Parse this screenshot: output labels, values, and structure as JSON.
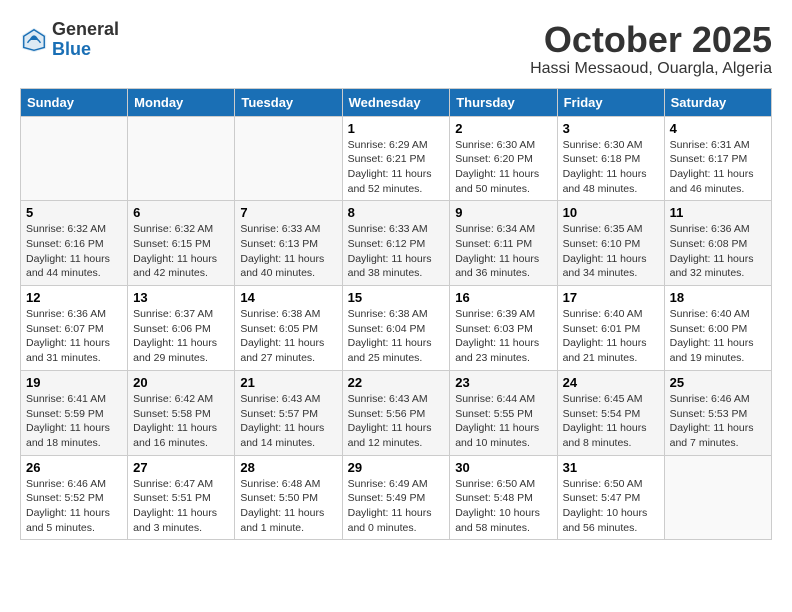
{
  "header": {
    "logo_general": "General",
    "logo_blue": "Blue",
    "month": "October 2025",
    "location": "Hassi Messaoud, Ouargla, Algeria"
  },
  "weekdays": [
    "Sunday",
    "Monday",
    "Tuesday",
    "Wednesday",
    "Thursday",
    "Friday",
    "Saturday"
  ],
  "weeks": [
    [
      {
        "day": "",
        "sunrise": "",
        "sunset": "",
        "daylight": ""
      },
      {
        "day": "",
        "sunrise": "",
        "sunset": "",
        "daylight": ""
      },
      {
        "day": "",
        "sunrise": "",
        "sunset": "",
        "daylight": ""
      },
      {
        "day": "1",
        "sunrise": "Sunrise: 6:29 AM",
        "sunset": "Sunset: 6:21 PM",
        "daylight": "Daylight: 11 hours and 52 minutes."
      },
      {
        "day": "2",
        "sunrise": "Sunrise: 6:30 AM",
        "sunset": "Sunset: 6:20 PM",
        "daylight": "Daylight: 11 hours and 50 minutes."
      },
      {
        "day": "3",
        "sunrise": "Sunrise: 6:30 AM",
        "sunset": "Sunset: 6:18 PM",
        "daylight": "Daylight: 11 hours and 48 minutes."
      },
      {
        "day": "4",
        "sunrise": "Sunrise: 6:31 AM",
        "sunset": "Sunset: 6:17 PM",
        "daylight": "Daylight: 11 hours and 46 minutes."
      }
    ],
    [
      {
        "day": "5",
        "sunrise": "Sunrise: 6:32 AM",
        "sunset": "Sunset: 6:16 PM",
        "daylight": "Daylight: 11 hours and 44 minutes."
      },
      {
        "day": "6",
        "sunrise": "Sunrise: 6:32 AM",
        "sunset": "Sunset: 6:15 PM",
        "daylight": "Daylight: 11 hours and 42 minutes."
      },
      {
        "day": "7",
        "sunrise": "Sunrise: 6:33 AM",
        "sunset": "Sunset: 6:13 PM",
        "daylight": "Daylight: 11 hours and 40 minutes."
      },
      {
        "day": "8",
        "sunrise": "Sunrise: 6:33 AM",
        "sunset": "Sunset: 6:12 PM",
        "daylight": "Daylight: 11 hours and 38 minutes."
      },
      {
        "day": "9",
        "sunrise": "Sunrise: 6:34 AM",
        "sunset": "Sunset: 6:11 PM",
        "daylight": "Daylight: 11 hours and 36 minutes."
      },
      {
        "day": "10",
        "sunrise": "Sunrise: 6:35 AM",
        "sunset": "Sunset: 6:10 PM",
        "daylight": "Daylight: 11 hours and 34 minutes."
      },
      {
        "day": "11",
        "sunrise": "Sunrise: 6:36 AM",
        "sunset": "Sunset: 6:08 PM",
        "daylight": "Daylight: 11 hours and 32 minutes."
      }
    ],
    [
      {
        "day": "12",
        "sunrise": "Sunrise: 6:36 AM",
        "sunset": "Sunset: 6:07 PM",
        "daylight": "Daylight: 11 hours and 31 minutes."
      },
      {
        "day": "13",
        "sunrise": "Sunrise: 6:37 AM",
        "sunset": "Sunset: 6:06 PM",
        "daylight": "Daylight: 11 hours and 29 minutes."
      },
      {
        "day": "14",
        "sunrise": "Sunrise: 6:38 AM",
        "sunset": "Sunset: 6:05 PM",
        "daylight": "Daylight: 11 hours and 27 minutes."
      },
      {
        "day": "15",
        "sunrise": "Sunrise: 6:38 AM",
        "sunset": "Sunset: 6:04 PM",
        "daylight": "Daylight: 11 hours and 25 minutes."
      },
      {
        "day": "16",
        "sunrise": "Sunrise: 6:39 AM",
        "sunset": "Sunset: 6:03 PM",
        "daylight": "Daylight: 11 hours and 23 minutes."
      },
      {
        "day": "17",
        "sunrise": "Sunrise: 6:40 AM",
        "sunset": "Sunset: 6:01 PM",
        "daylight": "Daylight: 11 hours and 21 minutes."
      },
      {
        "day": "18",
        "sunrise": "Sunrise: 6:40 AM",
        "sunset": "Sunset: 6:00 PM",
        "daylight": "Daylight: 11 hours and 19 minutes."
      }
    ],
    [
      {
        "day": "19",
        "sunrise": "Sunrise: 6:41 AM",
        "sunset": "Sunset: 5:59 PM",
        "daylight": "Daylight: 11 hours and 18 minutes."
      },
      {
        "day": "20",
        "sunrise": "Sunrise: 6:42 AM",
        "sunset": "Sunset: 5:58 PM",
        "daylight": "Daylight: 11 hours and 16 minutes."
      },
      {
        "day": "21",
        "sunrise": "Sunrise: 6:43 AM",
        "sunset": "Sunset: 5:57 PM",
        "daylight": "Daylight: 11 hours and 14 minutes."
      },
      {
        "day": "22",
        "sunrise": "Sunrise: 6:43 AM",
        "sunset": "Sunset: 5:56 PM",
        "daylight": "Daylight: 11 hours and 12 minutes."
      },
      {
        "day": "23",
        "sunrise": "Sunrise: 6:44 AM",
        "sunset": "Sunset: 5:55 PM",
        "daylight": "Daylight: 11 hours and 10 minutes."
      },
      {
        "day": "24",
        "sunrise": "Sunrise: 6:45 AM",
        "sunset": "Sunset: 5:54 PM",
        "daylight": "Daylight: 11 hours and 8 minutes."
      },
      {
        "day": "25",
        "sunrise": "Sunrise: 6:46 AM",
        "sunset": "Sunset: 5:53 PM",
        "daylight": "Daylight: 11 hours and 7 minutes."
      }
    ],
    [
      {
        "day": "26",
        "sunrise": "Sunrise: 6:46 AM",
        "sunset": "Sunset: 5:52 PM",
        "daylight": "Daylight: 11 hours and 5 minutes."
      },
      {
        "day": "27",
        "sunrise": "Sunrise: 6:47 AM",
        "sunset": "Sunset: 5:51 PM",
        "daylight": "Daylight: 11 hours and 3 minutes."
      },
      {
        "day": "28",
        "sunrise": "Sunrise: 6:48 AM",
        "sunset": "Sunset: 5:50 PM",
        "daylight": "Daylight: 11 hours and 1 minute."
      },
      {
        "day": "29",
        "sunrise": "Sunrise: 6:49 AM",
        "sunset": "Sunset: 5:49 PM",
        "daylight": "Daylight: 11 hours and 0 minutes."
      },
      {
        "day": "30",
        "sunrise": "Sunrise: 6:50 AM",
        "sunset": "Sunset: 5:48 PM",
        "daylight": "Daylight: 10 hours and 58 minutes."
      },
      {
        "day": "31",
        "sunrise": "Sunrise: 6:50 AM",
        "sunset": "Sunset: 5:47 PM",
        "daylight": "Daylight: 10 hours and 56 minutes."
      },
      {
        "day": "",
        "sunrise": "",
        "sunset": "",
        "daylight": ""
      }
    ]
  ]
}
